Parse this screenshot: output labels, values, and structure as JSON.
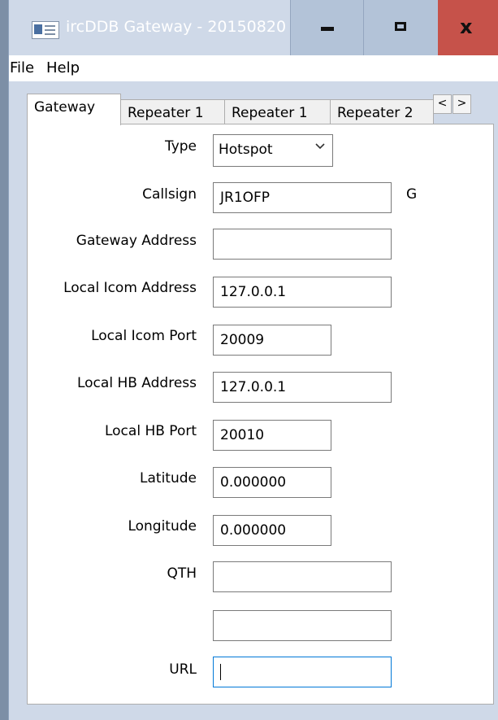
{
  "window": {
    "title": "ircDDB Gateway - 20150820",
    "close_glyph": "x"
  },
  "menu": {
    "file": "File",
    "help": "Help"
  },
  "tabs": [
    "Gateway",
    "Repeater 1",
    "Repeater 1",
    "Repeater 2"
  ],
  "tab_scroll": {
    "left": "<",
    "right": ">"
  },
  "form": {
    "type_label": "Type",
    "type_value": "Hotspot",
    "callsign_label": "Callsign",
    "callsign_value": "JR1OFP",
    "callsign_suffix": "G",
    "gateway_address_label": "Gateway Address",
    "gateway_address_value": "",
    "local_icom_address_label": "Local Icom Address",
    "local_icom_address_value": "127.0.0.1",
    "local_icom_port_label": "Local Icom Port",
    "local_icom_port_value": "20009",
    "local_hb_address_label": "Local HB Address",
    "local_hb_address_value": "127.0.0.1",
    "local_hb_port_label": "Local HB Port",
    "local_hb_port_value": "20010",
    "latitude_label": "Latitude",
    "latitude_value": "0.000000",
    "longitude_label": "Longitude",
    "longitude_value": "0.000000",
    "qth_label": "QTH",
    "qth_value": "",
    "qth2_value": "",
    "url_label": "URL",
    "url_value": ""
  },
  "icons": {
    "app": "app-window-icon",
    "minimize": "minimize-icon",
    "maximize": "maximize-icon",
    "close": "close-icon",
    "dropdown": "chevron-down-icon",
    "tab_left": "chevron-left-icon",
    "tab_right": "chevron-right-icon"
  },
  "colors": {
    "titlebar": "#cfd9e8",
    "close_button": "#c6524a",
    "focus_border": "#0078d7"
  }
}
